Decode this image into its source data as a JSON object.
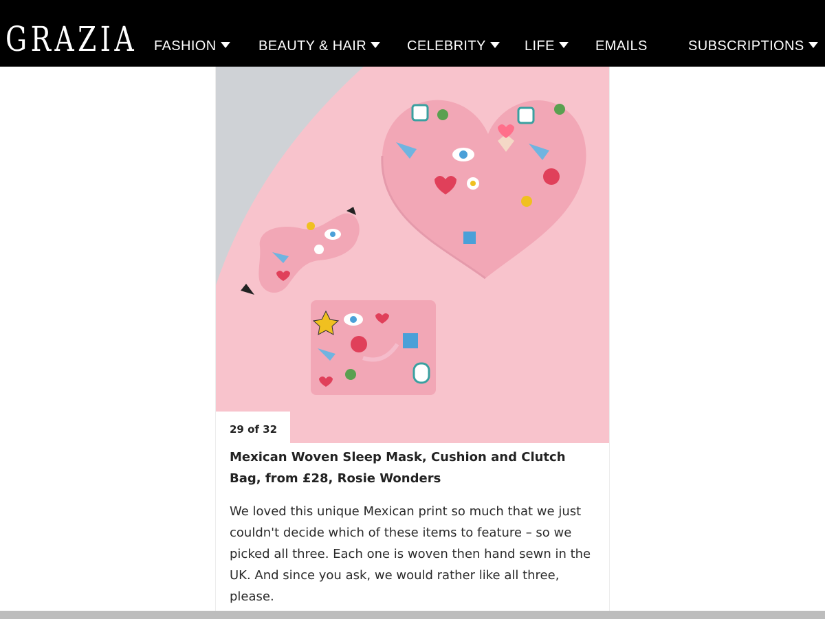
{
  "header": {
    "logo": "GRAZIA",
    "nav": [
      {
        "label": "FASHION",
        "dropdown": true
      },
      {
        "label": "BEAUTY & HAIR",
        "dropdown": true
      },
      {
        "label": "CELEBRITY",
        "dropdown": true
      },
      {
        "label": "LIFE",
        "dropdown": true
      },
      {
        "label": "EMAILS",
        "dropdown": false
      },
      {
        "label": "SUBSCRIPTIONS",
        "dropdown": true
      }
    ]
  },
  "gallery": {
    "counter": "29 of 32",
    "title": "Mexican Woven Sleep Mask, Cushion and Clutch Bag, from £28, Rosie Wonders",
    "description": "We loved this unique Mexican print so much that we just couldn't decide which of these items to feature – so we picked all three. Each one is woven then hand sewn in the UK. And since you ask, we would rather like all three, please."
  },
  "colors": {
    "header_bg": "#000000",
    "photo_bg": "#f8c3cc",
    "photo_grey": "#cfd2d6",
    "product_pink": "#f2a7b6"
  }
}
